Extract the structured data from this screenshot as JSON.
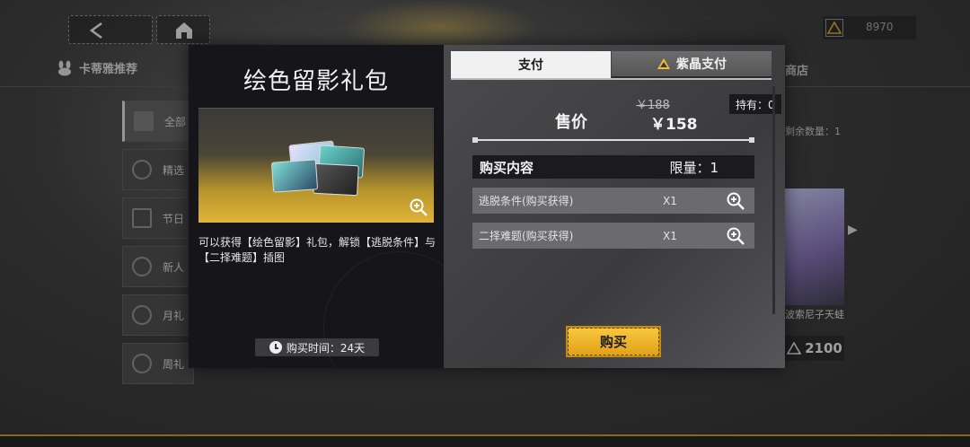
{
  "background": {
    "currency_value": "8970",
    "left_tab_label": "卡蒂雅推荐",
    "right_tab_label": "商店",
    "sidebar_items": [
      {
        "label": "全部"
      },
      {
        "label": "精选"
      },
      {
        "label": "节日"
      },
      {
        "label": "新人"
      },
      {
        "label": "月礼"
      },
      {
        "label": "周礼"
      }
    ],
    "right_remaining_label": "剩余数量：1",
    "right_card_label": "波索尼子天蛙",
    "right_card_price": "2100"
  },
  "modal": {
    "pack_title": "绘色留影礼包",
    "pack_description": "可以获得【绘色留影】礼包，解锁【逃脱条件】与【二择难题】插图",
    "purchase_time": "购买时间：24天",
    "tabs": [
      {
        "label": "支付",
        "active": true
      },
      {
        "label": "紫晶支付",
        "active": false
      }
    ],
    "holding": "持有：0",
    "price_label": "售价",
    "old_price": "￥188",
    "new_price": "￥158",
    "contents_title": "购买内容",
    "limit_label": "限量：1",
    "items": [
      {
        "name": "逃脱条件(购买获得)",
        "qty": "X1"
      },
      {
        "name": "二择难题(购买获得)",
        "qty": "X1"
      }
    ],
    "buy_label": "购买"
  },
  "colors": {
    "accent_gold": "#f2be35",
    "dark_panel": "#15151a"
  }
}
